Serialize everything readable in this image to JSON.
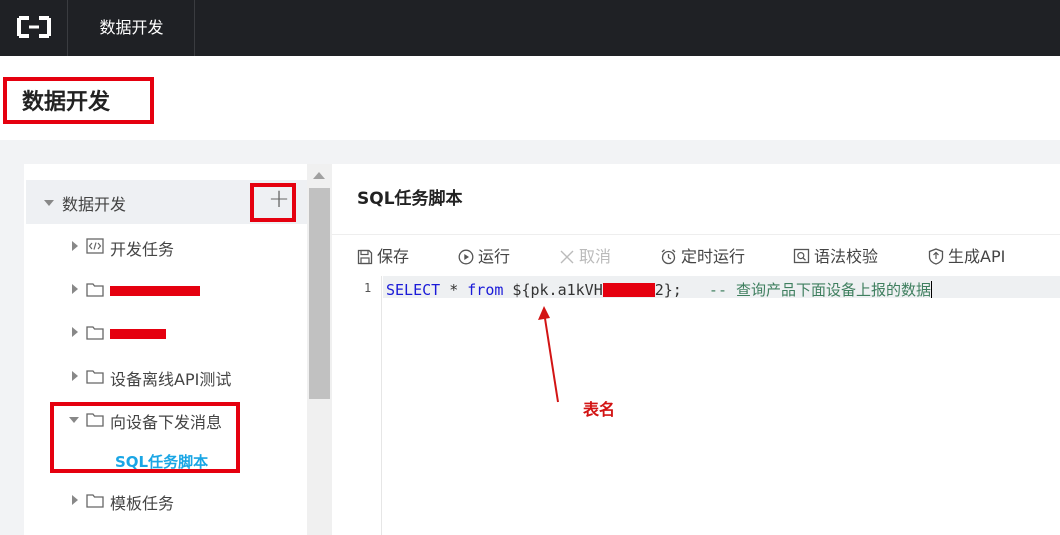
{
  "topbar": {
    "logo_icon": "aliyun-logo-icon",
    "title": "数据开发"
  },
  "page": {
    "title": "数据开发"
  },
  "sidebar": {
    "root": {
      "label": "数据开发",
      "add_button": "+"
    },
    "items": [
      {
        "label": "开发任务",
        "icon": "code-file-icon",
        "expanded": false
      },
      {
        "label": "",
        "icon": "folder-icon",
        "expanded": false,
        "redacted": true
      },
      {
        "label": "",
        "icon": "folder-icon",
        "expanded": false,
        "redacted": true
      },
      {
        "label": "设备离线API测试",
        "icon": "folder-icon",
        "expanded": false
      },
      {
        "label": "向设备下发消息",
        "icon": "folder-icon",
        "expanded": true
      },
      {
        "label": "模板任务",
        "icon": "folder-icon",
        "expanded": false
      }
    ],
    "selected_sub": "SQL任务脚本"
  },
  "main": {
    "title": "SQL任务脚本",
    "toolbar": {
      "save": "保存",
      "run": "运行",
      "cancel": "取消",
      "schedule": "定时运行",
      "check": "语法校验",
      "gen_api": "生成API"
    },
    "editor": {
      "line_number": "1",
      "kw_select": "SELECT",
      "star": " * ",
      "kw_from": "from",
      "table_prefix": " ${pk.a1kVH",
      "table_suffix": "2};",
      "comment": "   -- 查询产品下面设备上报的数据"
    }
  },
  "annotation": {
    "label": "表名",
    "color": "#d21414"
  },
  "colors": {
    "highlight": "#e5000f",
    "accent": "#1aa6e5",
    "topbar": "#1f2125"
  }
}
